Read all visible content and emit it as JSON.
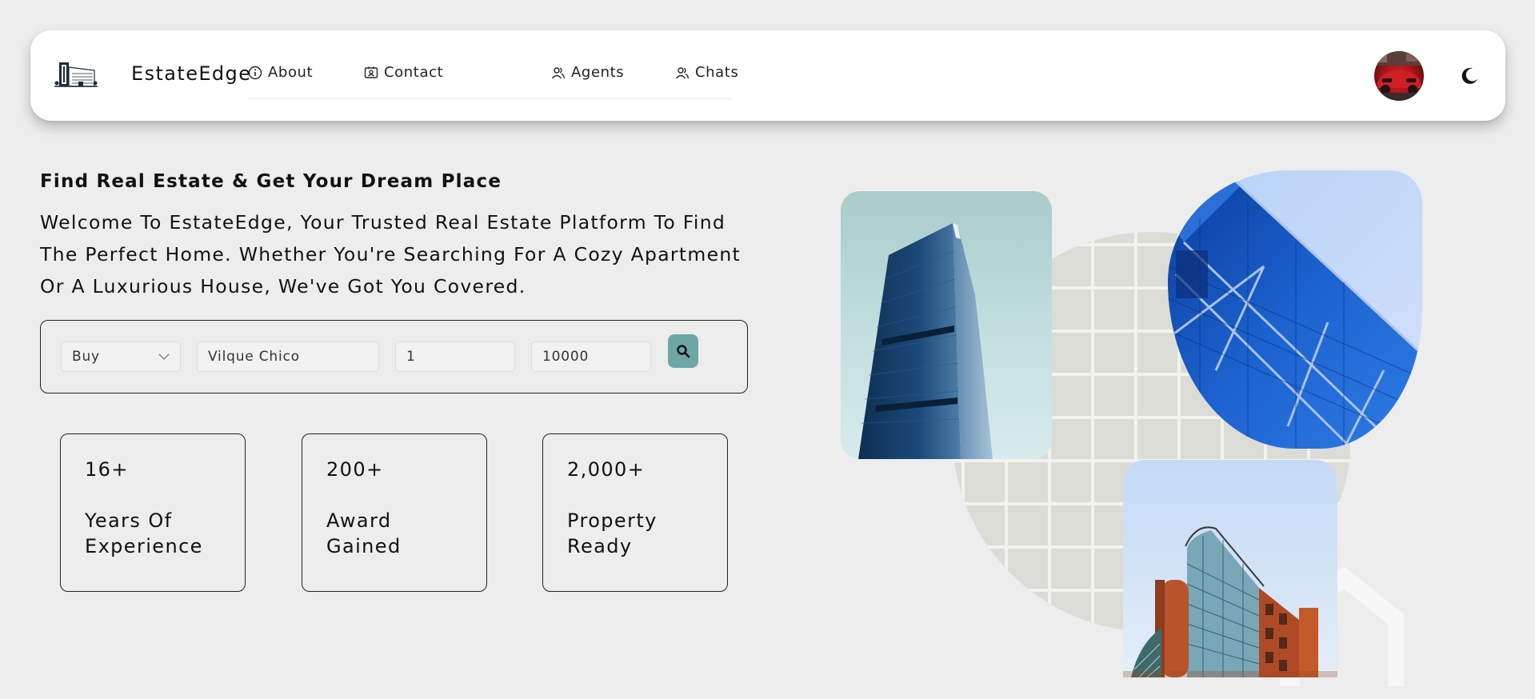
{
  "header": {
    "brand": "EstateEdge",
    "nav": [
      {
        "label": "About",
        "icon": "info-icon"
      },
      {
        "label": "Contact",
        "icon": "contact-card-icon"
      },
      {
        "label": "Agents",
        "icon": "people-icon"
      },
      {
        "label": "Chats",
        "icon": "people-icon"
      }
    ],
    "theme_icon": "moon-icon"
  },
  "hero": {
    "title": "Find Real Estate & Get Your Dream Place",
    "description": "Welcome To EstateEdge, Your Trusted Real Estate Platform To Find The Perfect Home. Whether You're Searching For A Cozy Apartment Or A Luxurious House, We've Got You Covered."
  },
  "search": {
    "type_selected": "Buy",
    "location_value": "Vilque Chico",
    "min_value": "1",
    "max_value": "10000",
    "button_icon": "search-icon"
  },
  "stats": [
    {
      "value": "16+",
      "label": "Years Of Experience"
    },
    {
      "value": "200+",
      "label": "Award Gained"
    },
    {
      "value": "2,000+",
      "label": "Property Ready"
    }
  ],
  "colors": {
    "background": "#ededed",
    "accent": "#6ea6a6",
    "card_border": "#222222"
  }
}
